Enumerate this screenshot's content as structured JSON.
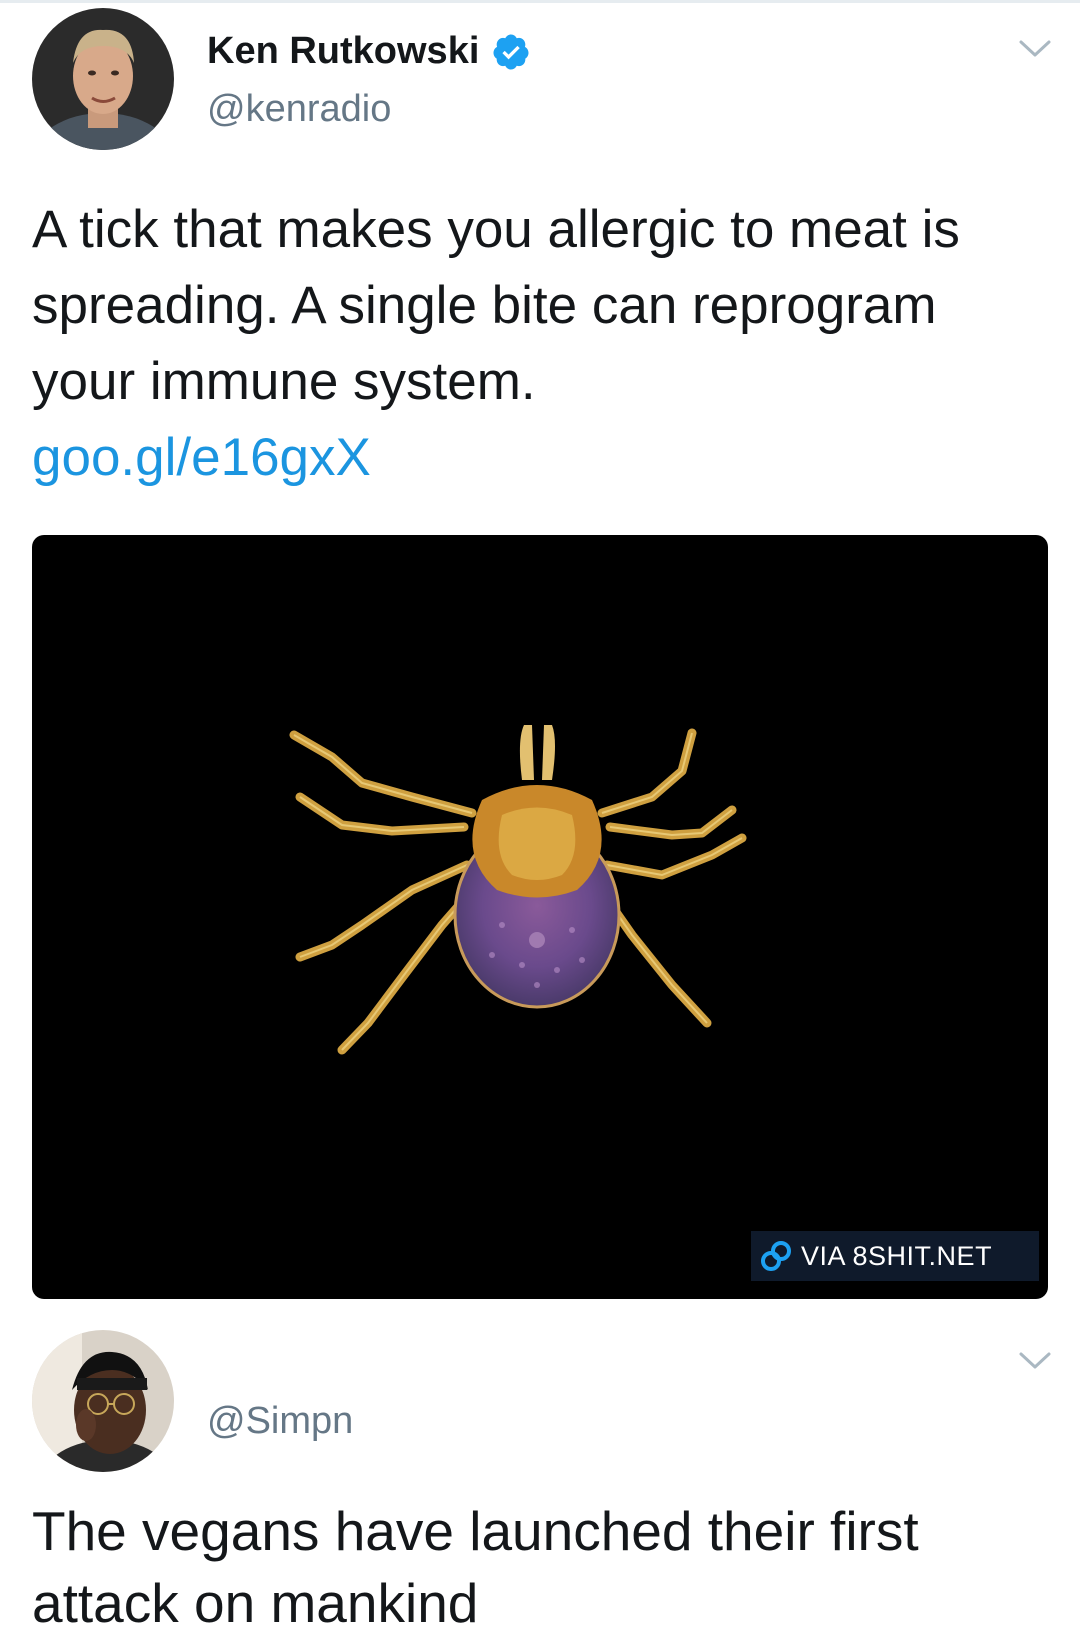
{
  "tweets": [
    {
      "author": {
        "display_name": "Ken Rutkowski",
        "handle": "@kenradio",
        "verified": true
      },
      "text": "A tick that makes you allergic to meat is spreading. A single bite can reprogram your immune system.",
      "link": "goo.gl/e16gxX",
      "media": {
        "watermark": "VIA 8SHIT.NET"
      }
    },
    {
      "author": {
        "display_name": "",
        "handle": "@Simpn",
        "verified": false
      },
      "text": "The vegans have launched their first attack on mankind"
    }
  ],
  "icons": {
    "verified": "verified-badge-icon",
    "menu": "chevron-down-icon",
    "watermark_logo": "link-chain-icon"
  },
  "colors": {
    "link": "#1b95e0",
    "verified": "#1da1f2",
    "secondary_text": "#657786",
    "media_background": "#000000"
  }
}
